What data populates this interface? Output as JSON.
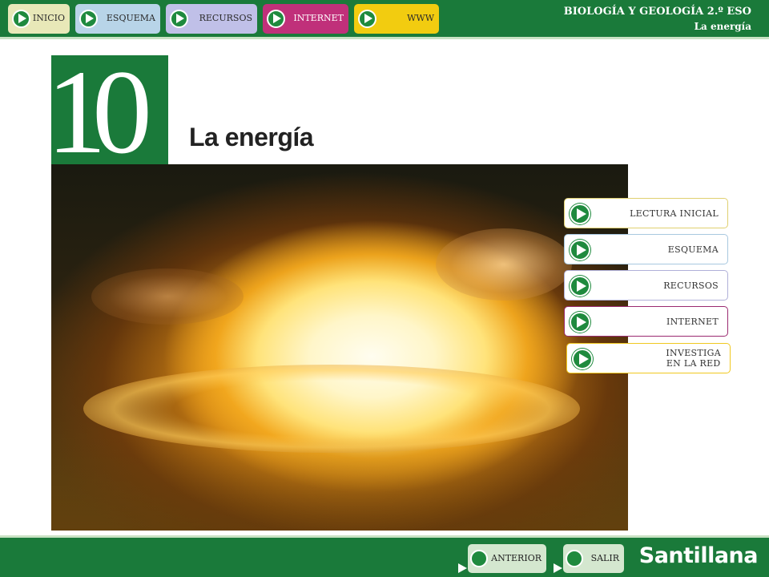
{
  "header": {
    "nav": [
      {
        "label": "INICIO",
        "color": "#e8e8b8"
      },
      {
        "label": "ESQUEMA",
        "color": "#b8d4e8"
      },
      {
        "label": "RECURSOS",
        "color": "#c0c0e8"
      },
      {
        "label": "INTERNET",
        "color": "#c0307a"
      },
      {
        "label": "WWW",
        "color": "#f2cc10"
      }
    ],
    "book_title": "BIOLOGÍA Y GEOLOGÍA 2.º ESO",
    "book_subtitle": "La energía"
  },
  "chapter": {
    "number": "10",
    "title": "La energía"
  },
  "side_menu": [
    {
      "label": "LECTURA INICIAL",
      "border": "#e0d070"
    },
    {
      "label": "ESQUEMA",
      "border": "#a8c8e0"
    },
    {
      "label": "RECURSOS",
      "border": "#b0b0d8"
    },
    {
      "label": "INTERNET",
      "border": "#9a2a70"
    },
    {
      "label": "INVESTIGA EN LA RED",
      "line1": "INVESTIGA",
      "line2": "EN LA RED",
      "border": "#f0c820"
    }
  ],
  "footer": {
    "prev_label": "ANTERIOR",
    "exit_label": "SALIR",
    "brand": "Santillana"
  },
  "colors": {
    "primary_green": "#1a7a3a",
    "accent_green": "#1f8a3e"
  }
}
